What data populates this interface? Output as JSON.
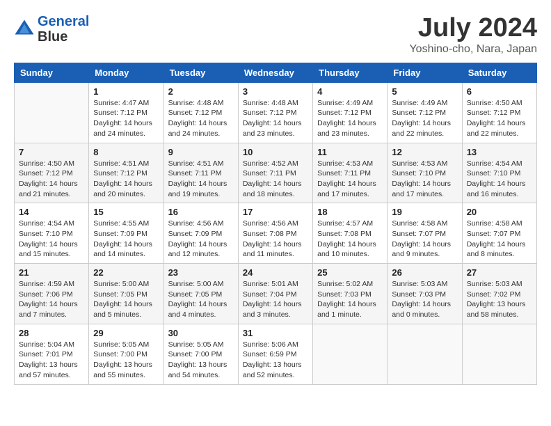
{
  "header": {
    "logo_line1": "General",
    "logo_line2": "Blue",
    "month_title": "July 2024",
    "location": "Yoshino-cho, Nara, Japan"
  },
  "days_of_week": [
    "Sunday",
    "Monday",
    "Tuesday",
    "Wednesday",
    "Thursday",
    "Friday",
    "Saturday"
  ],
  "weeks": [
    [
      {
        "day": "",
        "info": ""
      },
      {
        "day": "1",
        "info": "Sunrise: 4:47 AM\nSunset: 7:12 PM\nDaylight: 14 hours\nand 24 minutes."
      },
      {
        "day": "2",
        "info": "Sunrise: 4:48 AM\nSunset: 7:12 PM\nDaylight: 14 hours\nand 24 minutes."
      },
      {
        "day": "3",
        "info": "Sunrise: 4:48 AM\nSunset: 7:12 PM\nDaylight: 14 hours\nand 23 minutes."
      },
      {
        "day": "4",
        "info": "Sunrise: 4:49 AM\nSunset: 7:12 PM\nDaylight: 14 hours\nand 23 minutes."
      },
      {
        "day": "5",
        "info": "Sunrise: 4:49 AM\nSunset: 7:12 PM\nDaylight: 14 hours\nand 22 minutes."
      },
      {
        "day": "6",
        "info": "Sunrise: 4:50 AM\nSunset: 7:12 PM\nDaylight: 14 hours\nand 22 minutes."
      }
    ],
    [
      {
        "day": "7",
        "info": "Sunrise: 4:50 AM\nSunset: 7:12 PM\nDaylight: 14 hours\nand 21 minutes."
      },
      {
        "day": "8",
        "info": "Sunrise: 4:51 AM\nSunset: 7:12 PM\nDaylight: 14 hours\nand 20 minutes."
      },
      {
        "day": "9",
        "info": "Sunrise: 4:51 AM\nSunset: 7:11 PM\nDaylight: 14 hours\nand 19 minutes."
      },
      {
        "day": "10",
        "info": "Sunrise: 4:52 AM\nSunset: 7:11 PM\nDaylight: 14 hours\nand 18 minutes."
      },
      {
        "day": "11",
        "info": "Sunrise: 4:53 AM\nSunset: 7:11 PM\nDaylight: 14 hours\nand 17 minutes."
      },
      {
        "day": "12",
        "info": "Sunrise: 4:53 AM\nSunset: 7:10 PM\nDaylight: 14 hours\nand 17 minutes."
      },
      {
        "day": "13",
        "info": "Sunrise: 4:54 AM\nSunset: 7:10 PM\nDaylight: 14 hours\nand 16 minutes."
      }
    ],
    [
      {
        "day": "14",
        "info": "Sunrise: 4:54 AM\nSunset: 7:10 PM\nDaylight: 14 hours\nand 15 minutes."
      },
      {
        "day": "15",
        "info": "Sunrise: 4:55 AM\nSunset: 7:09 PM\nDaylight: 14 hours\nand 14 minutes."
      },
      {
        "day": "16",
        "info": "Sunrise: 4:56 AM\nSunset: 7:09 PM\nDaylight: 14 hours\nand 12 minutes."
      },
      {
        "day": "17",
        "info": "Sunrise: 4:56 AM\nSunset: 7:08 PM\nDaylight: 14 hours\nand 11 minutes."
      },
      {
        "day": "18",
        "info": "Sunrise: 4:57 AM\nSunset: 7:08 PM\nDaylight: 14 hours\nand 10 minutes."
      },
      {
        "day": "19",
        "info": "Sunrise: 4:58 AM\nSunset: 7:07 PM\nDaylight: 14 hours\nand 9 minutes."
      },
      {
        "day": "20",
        "info": "Sunrise: 4:58 AM\nSunset: 7:07 PM\nDaylight: 14 hours\nand 8 minutes."
      }
    ],
    [
      {
        "day": "21",
        "info": "Sunrise: 4:59 AM\nSunset: 7:06 PM\nDaylight: 14 hours\nand 7 minutes."
      },
      {
        "day": "22",
        "info": "Sunrise: 5:00 AM\nSunset: 7:05 PM\nDaylight: 14 hours\nand 5 minutes."
      },
      {
        "day": "23",
        "info": "Sunrise: 5:00 AM\nSunset: 7:05 PM\nDaylight: 14 hours\nand 4 minutes."
      },
      {
        "day": "24",
        "info": "Sunrise: 5:01 AM\nSunset: 7:04 PM\nDaylight: 14 hours\nand 3 minutes."
      },
      {
        "day": "25",
        "info": "Sunrise: 5:02 AM\nSunset: 7:03 PM\nDaylight: 14 hours\nand 1 minute."
      },
      {
        "day": "26",
        "info": "Sunrise: 5:03 AM\nSunset: 7:03 PM\nDaylight: 14 hours\nand 0 minutes."
      },
      {
        "day": "27",
        "info": "Sunrise: 5:03 AM\nSunset: 7:02 PM\nDaylight: 13 hours\nand 58 minutes."
      }
    ],
    [
      {
        "day": "28",
        "info": "Sunrise: 5:04 AM\nSunset: 7:01 PM\nDaylight: 13 hours\nand 57 minutes."
      },
      {
        "day": "29",
        "info": "Sunrise: 5:05 AM\nSunset: 7:00 PM\nDaylight: 13 hours\nand 55 minutes."
      },
      {
        "day": "30",
        "info": "Sunrise: 5:05 AM\nSunset: 7:00 PM\nDaylight: 13 hours\nand 54 minutes."
      },
      {
        "day": "31",
        "info": "Sunrise: 5:06 AM\nSunset: 6:59 PM\nDaylight: 13 hours\nand 52 minutes."
      },
      {
        "day": "",
        "info": ""
      },
      {
        "day": "",
        "info": ""
      },
      {
        "day": "",
        "info": ""
      }
    ]
  ]
}
